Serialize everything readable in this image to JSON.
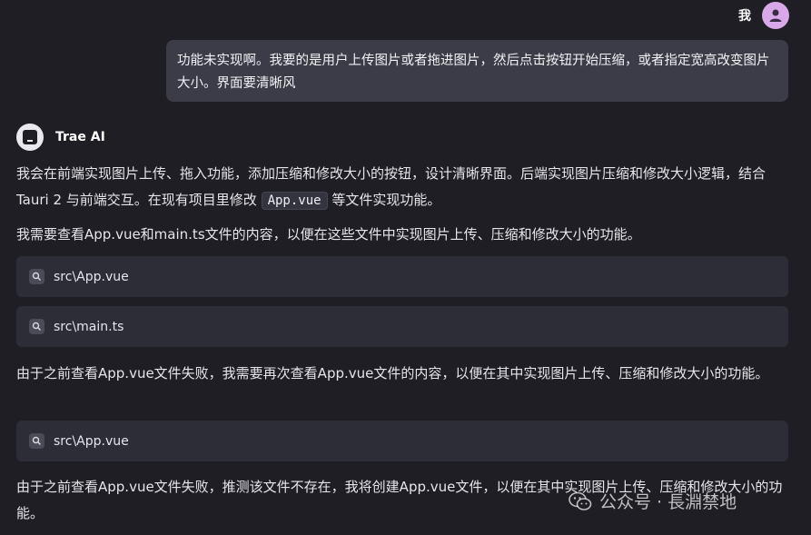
{
  "user": {
    "name": "我",
    "message": "功能未实现啊。我要的是用户上传图片或者拖进图片，然后点击按钮开始压缩，或者指定宽高改变图片大小。界面要清晰风"
  },
  "ai": {
    "name": "Trae AI",
    "para1_before": "我会在前端实现图片上传、拖入功能，添加压缩和修改大小的按钮，设计清晰界面。后端实现图片压缩和修改大小逻辑，结合 Tauri 2 与前端交互。在现有项目里修改 ",
    "para1_code": "App.vue",
    "para1_after": " 等文件实现功能。",
    "para2": "我需要查看App.vue和main.ts文件的内容，以便在这些文件中实现图片上传、压缩和修改大小的功能。",
    "files1": [
      "src\\App.vue",
      "src\\main.ts"
    ],
    "para3": "由于之前查看App.vue文件失败，我需要再次查看App.vue文件的内容，以便在其中实现图片上传、压缩和修改大小的功能。",
    "files2": [
      "src\\App.vue"
    ],
    "para4": "由于之前查看App.vue文件失败，推测该文件不存在，我将创建App.vue文件，以便在其中实现图片上传、压缩和修改大小的功能。"
  },
  "watermark": "公众号 · 長淵禁地",
  "icons": {
    "user_avatar": "person-icon",
    "ai_avatar": "terminal-icon",
    "file": "search-icon",
    "watermark": "wechat-icon"
  },
  "colors": {
    "background": "#1e1e24",
    "user_bubble": "#3b3c48",
    "file_card": "#2c2d37",
    "user_avatar": "#d9a8e8"
  }
}
